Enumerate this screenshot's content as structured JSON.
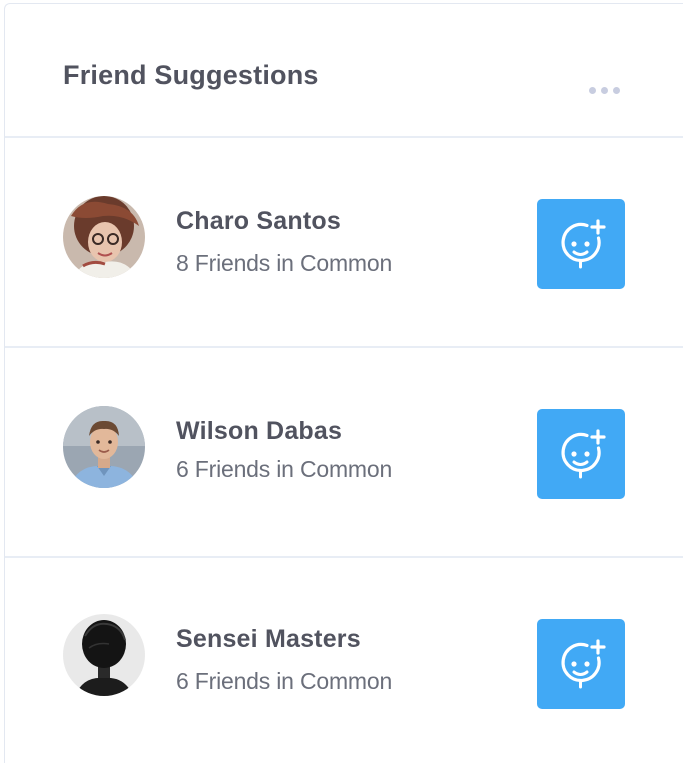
{
  "widget": {
    "title": "Friend Suggestions",
    "more_icon": "more-horizontal-icon"
  },
  "colors": {
    "accent": "#41a9f5",
    "title_text": "#51535f",
    "meta_text": "#6b6f7b",
    "divider": "#e8edf5"
  },
  "suggestions": [
    {
      "name": "Charo Santos",
      "mutual": "8 Friends in Common",
      "add_icon": "add-friend-icon"
    },
    {
      "name": "Wilson Dabas",
      "mutual": "6 Friends in Common",
      "add_icon": "add-friend-icon"
    },
    {
      "name": "Sensei Masters",
      "mutual": "6 Friends in Common",
      "add_icon": "add-friend-icon"
    }
  ]
}
